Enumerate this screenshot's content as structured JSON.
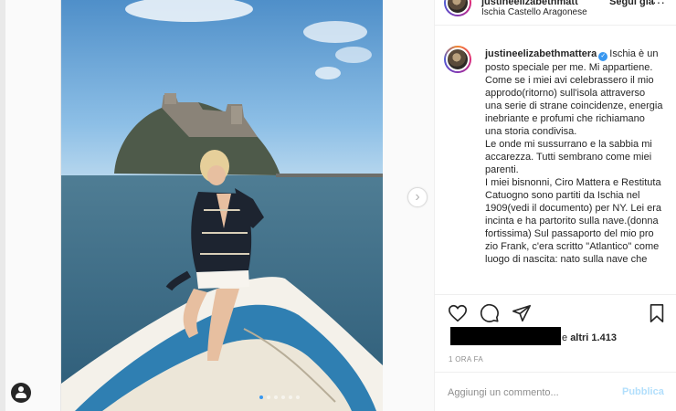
{
  "post": {
    "username_truncated": "justineelizabethmatt",
    "follow_label": "Segui già",
    "location": "Ischia Castello Aragonese",
    "more_label": "···",
    "caption_username": "justineelizabethmattera",
    "verified_symbol": "✓",
    "caption_body": "Ischia è un posto speciale per me. Mi appartiene. Come se i miei avi celebrassero il mio approdo(ritorno) sull'isola attraverso una serie di strane coincidenze, energia inebriante e profumi che richiamano una storia condivisa.\nLe onde mi sussurrano e la sabbia mi accarezza. Tutti sembrano come miei parenti.\nI miei bisnonni, Ciro Mattera e Restituta Catuogno sono partiti da Ischia nel 1909(vedi il documento) per NY. Lei era incinta e ha partorito sulla nave.(donna fortissima) Sul passaporto del mio pro zio Frank, c'era scritto \"Atlantico\" come luogo di nascita: nato sulla nave che",
    "likes_prefix": "e",
    "likes_rest": "altri 1.413",
    "time_ago": "1 ORA FA",
    "comment_placeholder": "Aggiungi un commento...",
    "publish_label": "Pubblica",
    "next_arrow": "›",
    "carousel": {
      "count": 6,
      "active_index": 0
    }
  },
  "icons": {
    "like": "heart-icon",
    "comment": "comment-icon",
    "share": "paper-plane-icon",
    "save": "bookmark-icon",
    "profile": "profile-icon"
  },
  "colors": {
    "link_blue": "#3897f0",
    "publish_disabled": "#b2dffc",
    "text": "#262626",
    "muted": "#8e8e8e"
  }
}
